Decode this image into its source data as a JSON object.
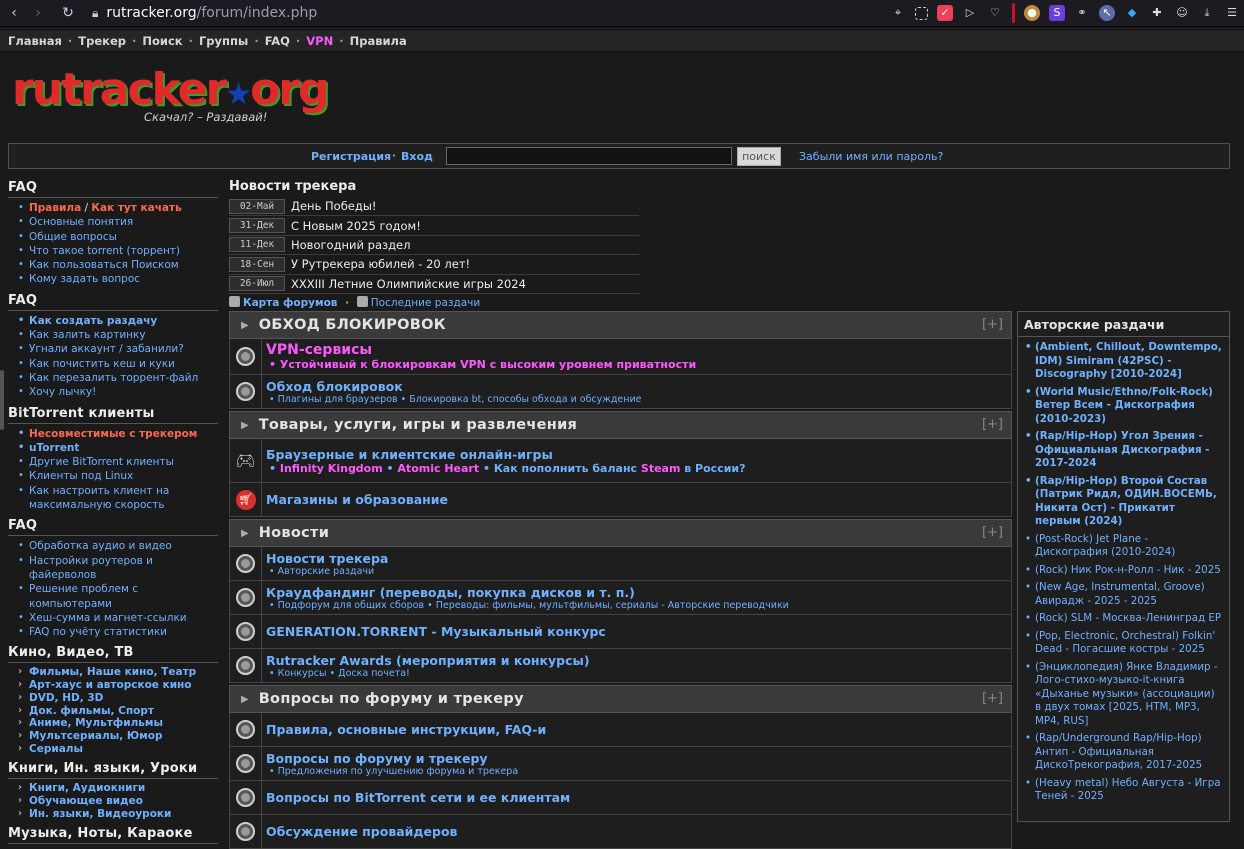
{
  "browser": {
    "url_host": "rutracker.org",
    "url_path": "/forum/index.php"
  },
  "topnav": {
    "items": [
      "Главная",
      "Трекер",
      "Поиск",
      "Группы",
      "FAQ",
      "VPN",
      "Правила"
    ]
  },
  "logo": {
    "text_main": "rutracker",
    "text_tld": "org",
    "slogan": "Скачал? – Раздавай!"
  },
  "login": {
    "register": "Регистрация",
    "enter": "Вход",
    "search_button": "поиск",
    "forgot": "Забыли имя или пароль?"
  },
  "sidebar": {
    "sections": [
      {
        "title": "FAQ"
      },
      {
        "title": "FAQ"
      },
      {
        "title": "BitTorrent клиенты"
      },
      {
        "title": "FAQ"
      },
      {
        "title": "Кино, Видео, ТВ"
      },
      {
        "title": "Книги, Ин. языки, Уроки"
      },
      {
        "title": "Музыка, Ноты, Караоке"
      }
    ],
    "faq1": {
      "rules": "Правила",
      "slash": " / ",
      "howto": "Как тут качать",
      "items": [
        "Основные понятия",
        "Общие вопросы",
        "Что такое torrent (торрент)",
        "Как пользоваться Поиском",
        "Кому задать вопрос"
      ]
    },
    "faq2": [
      "Как создать раздачу",
      "Как залить картинку",
      "Угнали аккаунт / забанили?",
      "Как почистить кеш и куки",
      "Как перезалить торрент-файл",
      "Хочу лычку!"
    ],
    "bt": [
      "Несовместимые с трекером",
      "uTorrent",
      "Другие BitTorrent клиенты",
      "Клиенты под Linux",
      "Как настроить клиент на максимальную скорость"
    ],
    "faq3": [
      "Обработка аудио и видео",
      "Настройки роутеров и файерволов",
      "Решение проблем с компьютерами",
      "Хеш-сумма и магнет-ссылки",
      "FAQ по учёту статистики"
    ],
    "kino": [
      "Фильмы, Наше кино, Театр",
      "Арт-хаус и авторское кино",
      "DVD, HD, 3D",
      "Док. фильмы, Спорт",
      "Аниме, Мультфильмы",
      "Мультсериалы, Юмор",
      "Сериалы"
    ],
    "books": [
      "Книги, Аудиокниги",
      "Обучающее видео",
      "Ин. языки, Видеоуроки"
    ]
  },
  "news": {
    "title": "Новости трекера",
    "items": [
      {
        "date": "02-Май",
        "text": "День Победы!"
      },
      {
        "date": "31-Дек",
        "text": "С Новым 2025 годом!"
      },
      {
        "date": "11-Дек",
        "text": "Новогодний раздел"
      },
      {
        "date": "18-Сен",
        "text": "У Рутрекера юбилей - 20 лет!"
      },
      {
        "date": "26-Июл",
        "text": "XXXIII Летние Олимпийские игры 2024"
      }
    ]
  },
  "maplinks": {
    "map": "Карта форумов",
    "sep": "·",
    "latest": "Последние раздачи"
  },
  "forum": {
    "toggle": "[+]",
    "cat1": "ОБХОД БЛОКИРОВОК",
    "vpn_title": "VPN-сервисы",
    "vpn_sub": "Устойчивый к блокировкам VPN с высоким уровнем приватности",
    "obhod_title": "Обход блокировок",
    "obhod_sub1": "Плагины для браузеров",
    "obhod_sub2": "Блокировка bt, способы обхода и обсуждение",
    "cat2": "Товары, услуги, игры и развлечения",
    "games_title": "Браузерные и клиентские онлайн-игры",
    "games_sub1": "Infinity Kingdom",
    "games_sub2": "Atomic Heart",
    "games_sub3a": "Как пополнить баланс ",
    "games_sub3b": "Steam",
    "games_sub3c": " в России?",
    "shops_title": "Магазины и образование",
    "cat3": "Новости",
    "news_title": "Новости трекера",
    "news_sub": "Авторские раздачи",
    "crowd_title": "Краудфандинг (переводы, покупка дисков и т. п.)",
    "crowd_sub1": "Подфорум для общих сборов",
    "crowd_sub2": "Переводы: фильмы, мультфильмы, сериалы - Авторские переводчики",
    "gen_title": "GENERATION.TORRENT - Музыкальный конкурс",
    "awards_title": "Rutracker Awards (мероприятия и конкурсы)",
    "awards_sub1": "Конкурсы",
    "awards_sub2": "Доска почета!",
    "cat4": "Вопросы по форуму и трекеру",
    "rules_title": "Правила, основные инструкции, FAQ-и",
    "q_title": "Вопросы по форуму и трекеру",
    "q_sub": "Предложения по улучшению форума и трекера",
    "bt_title": "Вопросы по BitTorrent сети и ее клиентам",
    "isp_title": "Обсуждение провайдеров"
  },
  "authors": {
    "title": "Авторские раздачи",
    "items": [
      "(Ambient, Chillout, Downtempo, IDM) Simiram (42PSC) - Discography [2010-2024]",
      "(World Music/Ethno/Folk-Rock) Ветер Всем - Дискография (2010-2023)",
      "(Rap/Hip-Hop) Угол Зрения - Официальная Дискография - 2017-2024",
      "(Rap/Hip-Hop) Второй Состав (Патрик Ридл, ОДИН.ВОСЕМЬ, Никита Ост) - Прикатит первым (2024)",
      "(Post-Rock) Jet Plane - Дискография (2010-2024)",
      "(Rock) Ник Рок-н-Ролл - Ник - 2025",
      "(New Age, Instrumental, Groove) Авирадж - 2025 - 2025",
      "(Rock) SLM - Москва-Ленинград EP",
      "(Pop, Electronic, Orchestral) Folkin' Dead - Погасшие костры - 2025",
      "(Энциклопедия) Янке Владимир - Лого-стихо-музыко-it-книга «Дыханье музыки» (ассоциации) в двух томах [2025, HTM, MP3, MP4, RUS]",
      "(Rap/Underground Rap/Hip-Hop) Антип - Официальная ДискоТрекография, 2017-2025",
      "(Heavy metal) Небо Августа - Игра Теней - 2025"
    ]
  }
}
